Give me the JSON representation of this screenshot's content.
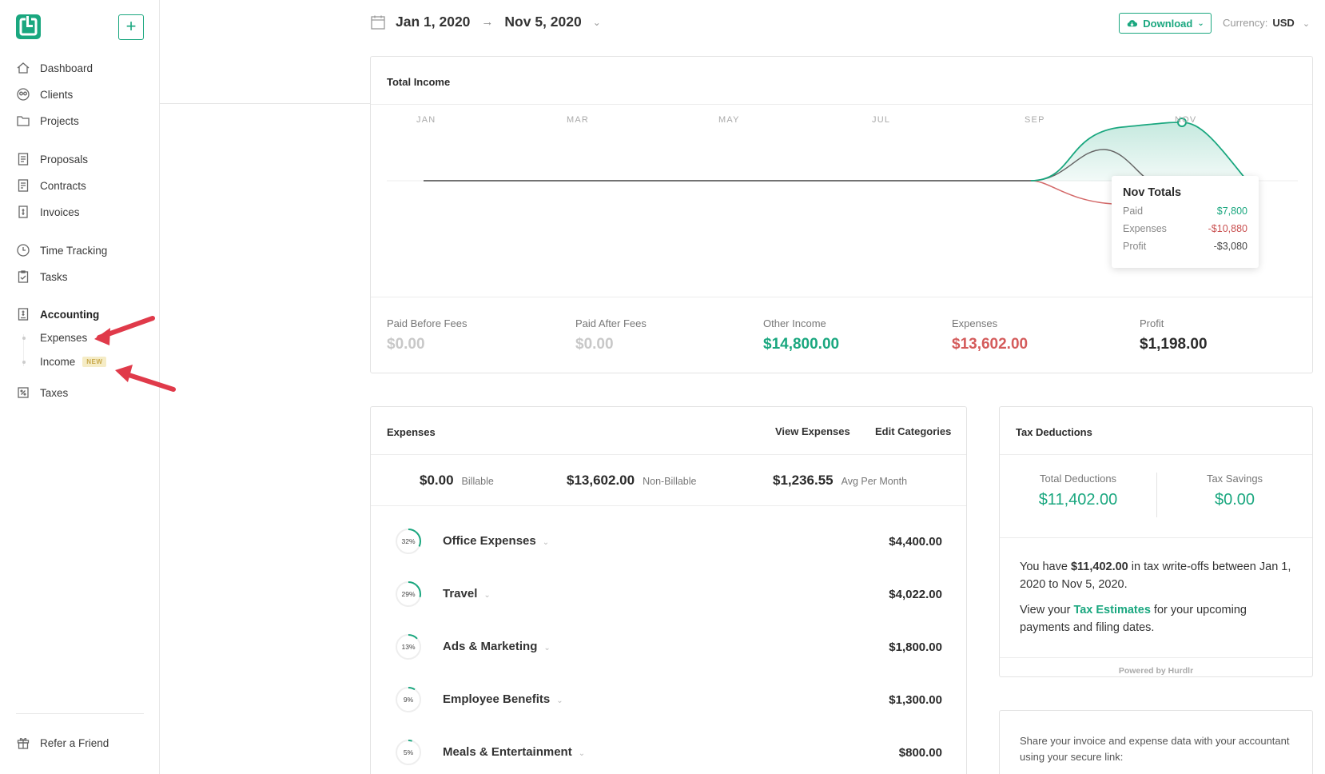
{
  "sidebar": {
    "add_label": "+",
    "items": [
      {
        "label": "Dashboard",
        "icon": "home-icon"
      },
      {
        "label": "Clients",
        "icon": "clients-icon"
      },
      {
        "label": "Projects",
        "icon": "folder-icon"
      },
      {
        "label": "Proposals",
        "icon": "proposal-icon"
      },
      {
        "label": "Contracts",
        "icon": "contract-icon"
      },
      {
        "label": "Invoices",
        "icon": "invoice-icon"
      },
      {
        "label": "Time Tracking",
        "icon": "clock-icon"
      },
      {
        "label": "Tasks",
        "icon": "tasks-icon"
      },
      {
        "label": "Accounting",
        "icon": "accounting-icon"
      },
      {
        "label": "Taxes",
        "icon": "taxes-icon"
      }
    ],
    "sub_items": [
      {
        "label": "Expenses"
      },
      {
        "label": "Income",
        "badge": "NEW"
      }
    ],
    "refer": "Refer a Friend"
  },
  "header": {
    "date_start": "Jan 1, 2020",
    "date_arrow": "→",
    "date_end": "Nov 5, 2020",
    "download_label": "Download",
    "currency_label": "Currency:",
    "currency_value": "USD"
  },
  "total_income": {
    "title": "Total Income",
    "months": [
      "JAN",
      "MAR",
      "MAY",
      "JUL",
      "SEP",
      "NOV"
    ],
    "tooltip": {
      "title": "Nov Totals",
      "rows": [
        {
          "label": "Paid",
          "value": "$7,800"
        },
        {
          "label": "Expenses",
          "value": "-$10,880"
        },
        {
          "label": "Profit",
          "value": "-$3,080"
        }
      ]
    },
    "stats": [
      {
        "label": "Paid Before Fees",
        "value": "$0.00"
      },
      {
        "label": "Paid After Fees",
        "value": "$0.00"
      },
      {
        "label": "Other Income",
        "value": "$14,800.00"
      },
      {
        "label": "Expenses",
        "value": "$13,602.00"
      },
      {
        "label": "Profit",
        "value": "$1,198.00"
      }
    ]
  },
  "expenses": {
    "title": "Expenses",
    "view_link": "View Expenses",
    "edit_link": "Edit Categories",
    "summary": [
      {
        "amount": "$0.00",
        "label": "Billable"
      },
      {
        "amount": "$13,602.00",
        "label": "Non-Billable"
      },
      {
        "amount": "$1,236.55",
        "label": "Avg Per Month"
      }
    ],
    "rows": [
      {
        "pct": "32%",
        "pct_value": 32,
        "name": "Office Expenses",
        "amount": "$4,400.00"
      },
      {
        "pct": "29%",
        "pct_value": 29,
        "name": "Travel",
        "amount": "$4,022.00"
      },
      {
        "pct": "13%",
        "pct_value": 13,
        "name": "Ads & Marketing",
        "amount": "$1,800.00"
      },
      {
        "pct": "9%",
        "pct_value": 9,
        "name": "Employee Benefits",
        "amount": "$1,300.00"
      },
      {
        "pct": "5%",
        "pct_value": 5,
        "name": "Meals & Entertainment",
        "amount": "$800.00"
      }
    ]
  },
  "tax": {
    "title": "Tax Deductions",
    "total_label": "Total Deductions",
    "total_value": "$11,402.00",
    "savings_label": "Tax Savings",
    "savings_value": "$0.00",
    "p1_a": "You have ",
    "p1_b": "$11,402.00",
    "p1_c": " in tax write-offs between Jan 1, 2020 to Nov 5, 2020.",
    "p2_a": "View your ",
    "p2_link": "Tax Estimates",
    "p2_c": " for your upcoming payments and filing dates.",
    "powered": "Powered by Hurdlr"
  },
  "share": {
    "text": "Share your invoice and expense data with your accountant using your secure link:"
  },
  "colors": {
    "accent": "#1aa77f",
    "expense_red": "#d45b5b",
    "annotation_arrow": "#e03a4a"
  }
}
